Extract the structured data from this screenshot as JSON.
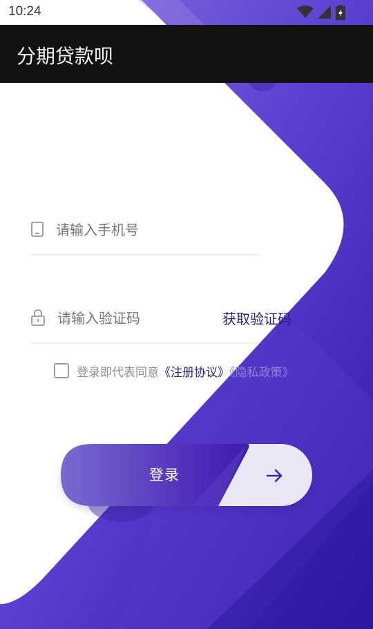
{
  "status_bar": {
    "time": "10:24"
  },
  "app_bar": {
    "title": "分期贷款呗"
  },
  "login_form": {
    "phone_placeholder": "请输入手机号",
    "code_placeholder": "请输入验证码",
    "get_code_label": "获取验证码",
    "agreement_prefix": "登录即代表同意",
    "agreement_link": "《注册协议》",
    "privacy_link": "《隐私政策》",
    "agreed": false,
    "login_label": "登录"
  },
  "colors": {
    "accent_deep": "#2b1d7a",
    "purple_light": "#7b63d6",
    "purple_dark": "#3c1fb0",
    "app_bar": "#121212"
  },
  "icons": [
    "wifi-icon",
    "signal-icon",
    "battery-icon",
    "phone-icon",
    "lock-icon",
    "arrow-right-icon"
  ]
}
